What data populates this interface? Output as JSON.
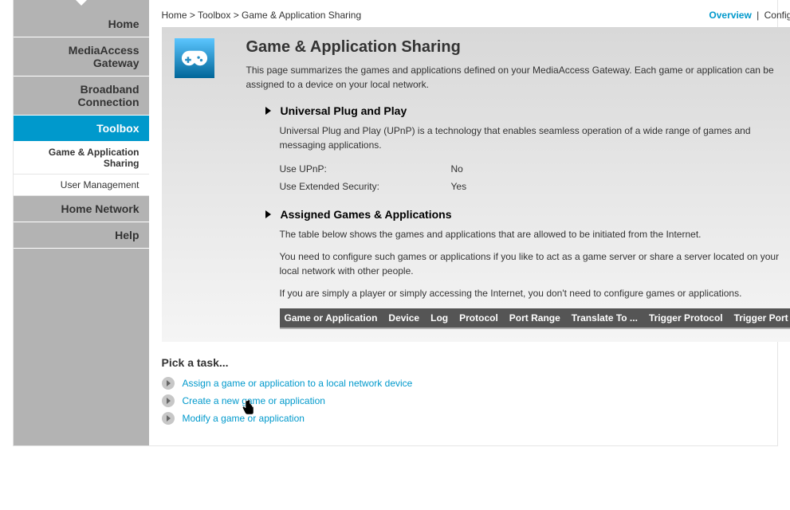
{
  "sidebar": {
    "items": [
      {
        "label": "Home"
      },
      {
        "label": "MediaAccess Gateway"
      },
      {
        "label": "Broadband Connection"
      },
      {
        "label": "Toolbox"
      },
      {
        "label": "Home Network"
      },
      {
        "label": "Help"
      }
    ],
    "sub": [
      {
        "label": "Game & Application Sharing"
      },
      {
        "label": "User Management"
      }
    ]
  },
  "breadcrumb": {
    "p0": "Home",
    "p1": "Toolbox",
    "p2": "Game & Application Sharing",
    "sep": " > "
  },
  "views": {
    "overview": "Overview",
    "configure": "Configure",
    "sep": "|"
  },
  "page": {
    "title": "Game & Application Sharing",
    "desc": "This page summarizes the games and applications defined on your MediaAccess Gateway. Each game or application can be assigned to a device on your local network."
  },
  "upnp": {
    "title": "Universal Plug and Play",
    "desc": "Universal Plug and Play (UPnP) is a technology that enables seamless operation of a wide range of games and messaging applications.",
    "rows": [
      {
        "k": "Use UPnP:",
        "v": "No"
      },
      {
        "k": "Use Extended Security:",
        "v": "Yes"
      }
    ]
  },
  "assigned": {
    "title": "Assigned Games & Applications",
    "p1": "The table below shows the games and applications that are allowed to be initiated from the Internet.",
    "p2": "You need to configure such games or applications if you like to act as a game server or share a server located on your local network with other people.",
    "p3": "If you are simply a player or simply accessing the Internet, you don't need to configure games or applications.",
    "columns": [
      "Game or Application",
      "Device",
      "Log",
      "Protocol",
      "Port Range",
      "Translate To ...",
      "Trigger Protocol",
      "Trigger Port"
    ]
  },
  "tasks": {
    "title": "Pick a task...",
    "items": [
      "Assign a game or application to a local network device",
      "Create a new game or application",
      "Modify a game or application"
    ]
  }
}
